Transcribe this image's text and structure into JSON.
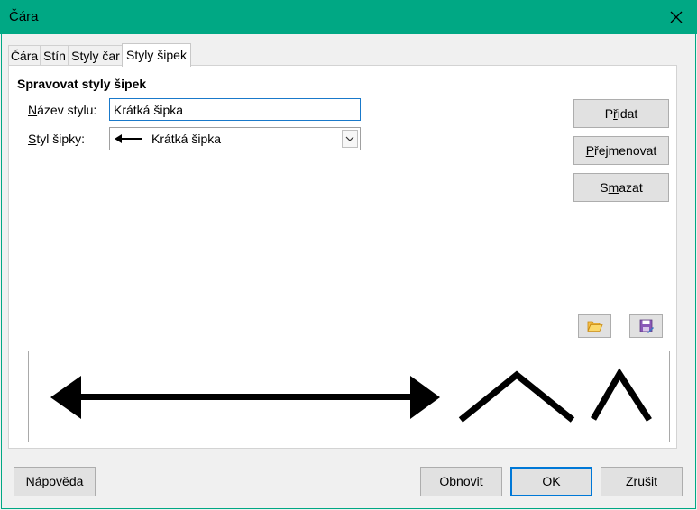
{
  "window": {
    "title": "Čára"
  },
  "tabs": [
    {
      "label": "Čára",
      "active": false
    },
    {
      "label": "Stín",
      "active": false
    },
    {
      "label": "Styly čar",
      "active": false
    },
    {
      "label": "Styly šipek",
      "active": true
    }
  ],
  "section": {
    "title": "Spravovat styly šipek"
  },
  "style_name": {
    "label_accel": "N",
    "label_rest": "ázev stylu:",
    "value": "Krátká šipka"
  },
  "arrow_style": {
    "label_accel": "S",
    "label_rest": "tyl šipky:",
    "selected": "Krátká šipka"
  },
  "side_buttons": {
    "add": {
      "pre": "P",
      "accel": "ř",
      "post": "idat"
    },
    "rename": {
      "pre": "",
      "accel": "P",
      "post": "řejmenovat"
    },
    "delete": {
      "pre": "S",
      "accel": "m",
      "post": "azat"
    }
  },
  "icons": {
    "open": "folder-open-icon",
    "save": "save-icon",
    "close": "close-icon",
    "dropdown": "chevron-down-icon"
  },
  "bottom_buttons": {
    "help": {
      "pre": "",
      "accel": "N",
      "post": "ápověda"
    },
    "reset": {
      "pre": "Ob",
      "accel": "n",
      "post": "ovit"
    },
    "ok": {
      "pre": "",
      "accel": "O",
      "post": "K"
    },
    "cancel": {
      "pre": "",
      "accel": "Z",
      "post": "rušit"
    }
  },
  "colors": {
    "titlebar": "#00a884",
    "accent": "#0078d7",
    "input_border": "#1979ca"
  }
}
